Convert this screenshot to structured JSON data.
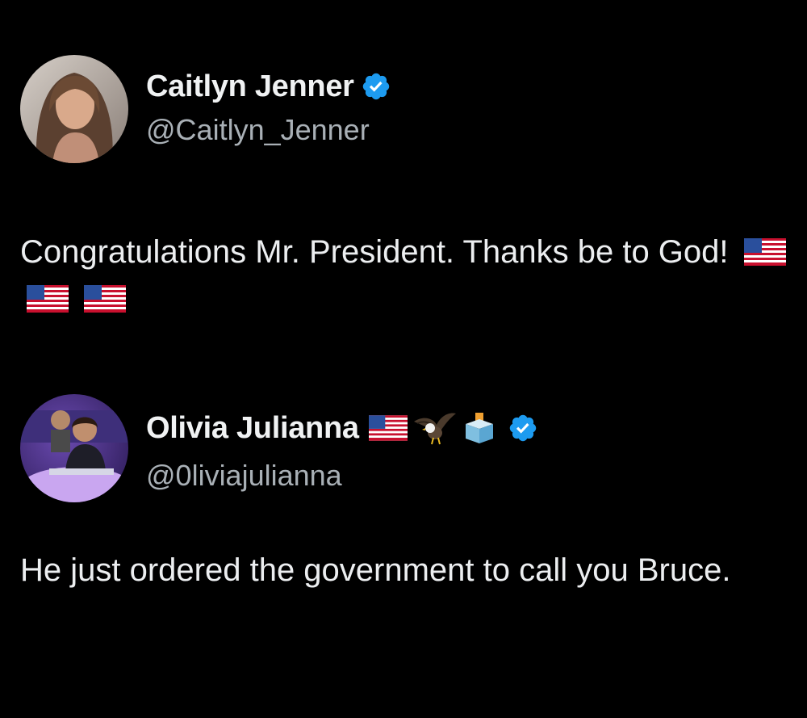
{
  "tweets": [
    {
      "author": {
        "display_name": "Caitlyn Jenner",
        "handle": "@Caitlyn_Jenner",
        "verified": true,
        "avatar": "caitlyn-profile-photo"
      },
      "text": "Congratulations Mr. President. Thanks be to God!",
      "text_emojis": [
        "us-flag-emoji",
        "us-flag-emoji",
        "us-flag-emoji"
      ]
    },
    {
      "author": {
        "display_name": "Olivia Julianna",
        "handle": "@0liviajulianna",
        "verified": true,
        "avatar": "olivia-profile-photo",
        "name_emojis": [
          "us-flag-emoji",
          "eagle-emoji",
          "ballot-box-emoji"
        ]
      },
      "text": "He just ordered the government to call you Bruce."
    }
  ],
  "colors": {
    "background": "#000000",
    "primary_text": "#e7e9ea",
    "secondary_text": "#a9b0b6",
    "verified_badge": "#1d9bf0"
  }
}
